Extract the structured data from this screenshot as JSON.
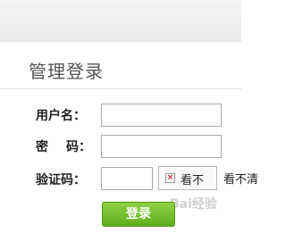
{
  "header": {
    "title": "管理登录"
  },
  "form": {
    "username_label": "用户名：",
    "password_label_part1": "密",
    "password_label_part2": "码：",
    "captcha_label": "验证码：",
    "username_value": "",
    "password_value": "",
    "captcha_value": ""
  },
  "captcha": {
    "alt_text": "看不",
    "refresh_link": "看不清"
  },
  "actions": {
    "login_label": "登录"
  },
  "watermark": {
    "text": "Bai经验"
  },
  "colors": {
    "button": "#6bb82a",
    "title": "#555555"
  }
}
